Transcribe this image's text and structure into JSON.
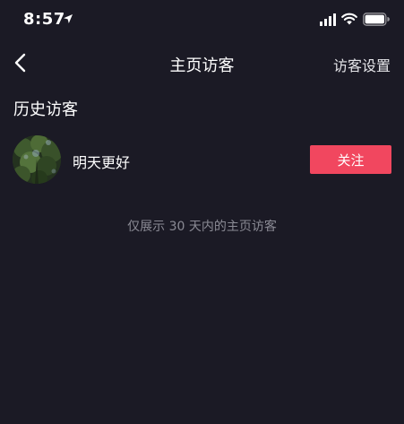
{
  "status_bar": {
    "time": "8:57",
    "icons": [
      "location-arrow-icon",
      "signal-icon",
      "wifi-icon",
      "battery-icon"
    ]
  },
  "nav": {
    "back_icon": "chevron-left-icon",
    "title": "主页访客",
    "settings_label": "访客设置"
  },
  "section": {
    "title": "历史访客"
  },
  "visitors": [
    {
      "name": "明天更好",
      "follow_label": "关注"
    }
  ],
  "footnote": "仅展示 30 天内的主页访客",
  "colors": {
    "background": "#1b1a25",
    "follow_button": "#f1475f",
    "muted_text": "#8a8a94"
  }
}
